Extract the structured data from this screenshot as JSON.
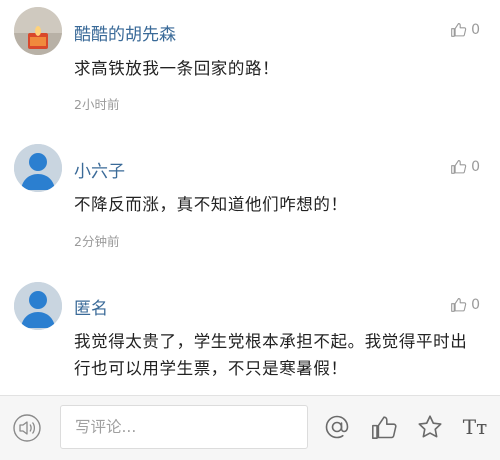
{
  "comments": [
    {
      "username": "酷酷的胡先森",
      "text": "求高铁放我一条回家的路！",
      "time": "2小时前",
      "likes": "0",
      "avatar": "photo-avatar"
    },
    {
      "username": "小六子",
      "text": "不降反而涨，真不知道他们咋想的！",
      "time": "2分钟前",
      "likes": "0",
      "avatar": "default-avatar"
    },
    {
      "username": "匿名",
      "text": "我觉得太贵了，学生党根本承担不起。我觉得平时出行也可以用学生票，不只是寒暑假！",
      "time": "",
      "likes": "0",
      "avatar": "default-avatar"
    }
  ],
  "bottom_bar": {
    "placeholder": "写评论...",
    "font_label": "Tт",
    "icons": [
      "speaker-icon",
      "at-icon",
      "thumbs-up-icon",
      "star-icon",
      "font-size-icon"
    ]
  },
  "colors": {
    "username": "#3a6a98",
    "meta": "#9a9a9a",
    "avatar_blue": "#2b7fd0"
  }
}
